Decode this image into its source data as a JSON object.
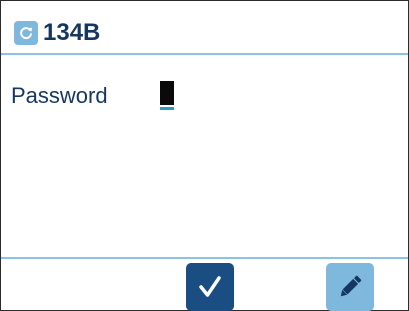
{
  "header": {
    "device_id": "134B",
    "refresh_icon": "refresh-icon"
  },
  "form": {
    "password_label": "Password",
    "password_value": ""
  },
  "footer": {
    "confirm_icon": "checkmark-icon",
    "edit_icon": "pencil-icon"
  },
  "colors": {
    "text_primary": "#14365f",
    "accent_light": "#7fb8dd",
    "accent_dark": "#1a4d82",
    "rule": "#8cc2e3",
    "caret": "#0a0a0a",
    "caret_underline": "#2a9bc9"
  }
}
